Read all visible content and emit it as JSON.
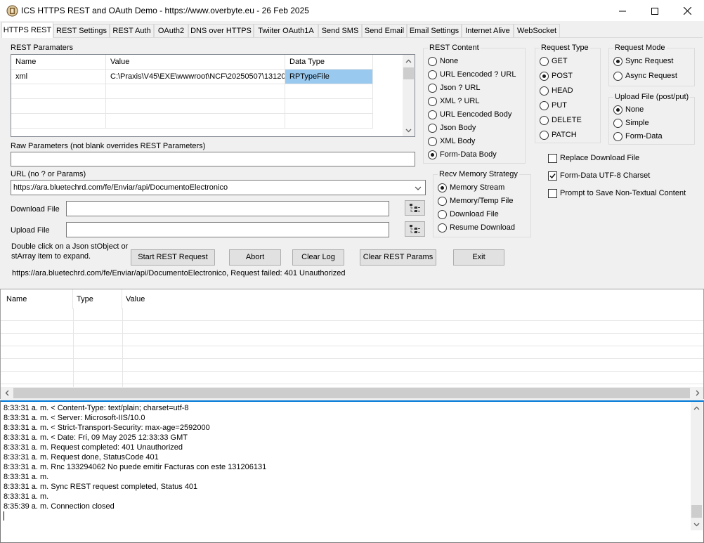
{
  "window": {
    "title": "ICS HTTPS REST and OAuth Demo - https://www.overbyte.eu  - 26 Feb 2025",
    "icons": [
      "app-icon",
      "minimize-icon",
      "maximize-icon",
      "close-icon"
    ]
  },
  "tabs": [
    "HTTPS REST",
    "REST Settings",
    "REST Auth",
    "OAuth2",
    "DNS over HTTPS",
    "Twiiter OAuth1A",
    "Send SMS",
    "Send Email",
    "Email Settings",
    "Internet Alive",
    "WebSocket"
  ],
  "rest_params": {
    "label": "REST Paramaters",
    "columns": [
      "Name",
      "Value",
      "Data Type"
    ],
    "rows": [
      {
        "name": "xml",
        "value": "C:\\Praxis\\V45\\EXE\\wwwroot\\NCF\\20250507\\13120",
        "type": "RPTypeFile"
      }
    ]
  },
  "raw_params": {
    "label": "Raw Parameters (not blank overrides REST Parameters)",
    "value": ""
  },
  "url": {
    "label": "URL (no ? or Params)",
    "value": "https://ara.bluetechrd.com/fe/Enviar/api/DocumentoElectronico"
  },
  "download_file": {
    "label": "Download File",
    "value": ""
  },
  "upload_file": {
    "label": "Upload File",
    "value": ""
  },
  "hint": {
    "line1": "Double click on a Json stObject or",
    "line2": "stArray item to expand."
  },
  "buttons": {
    "start": "Start REST Request",
    "abort": "Abort",
    "clear_log": "Clear Log",
    "clear_params": "Clear REST Params",
    "exit": "Exit"
  },
  "status_text": "https://ara.bluetechrd.com/fe/Enviar/api/DocumentoElectronico, Request failed: 401 Unauthorized",
  "rest_content": {
    "label": "REST Content",
    "options": [
      "None",
      "URL Eencoded ? URL",
      "Json ? URL",
      "XML ? URL",
      "URL Eencoded Body",
      "Json Body",
      "XML Body",
      "Form-Data Body"
    ],
    "selected": "Form-Data Body"
  },
  "request_type": {
    "label": "Request Type",
    "options": [
      "GET",
      "POST",
      "HEAD",
      "PUT",
      "DELETE",
      "PATCH"
    ],
    "selected": "POST"
  },
  "request_mode": {
    "label": "Request Mode",
    "options": [
      "Sync Request",
      "Async Request"
    ],
    "selected": "Sync Request"
  },
  "upload_mode": {
    "label": "Upload File (post/put)",
    "options": [
      "None",
      "Simple",
      "Form-Data"
    ],
    "selected": "None"
  },
  "checkboxes": {
    "replace_download": {
      "label": "Replace Download File",
      "checked": false
    },
    "utf8_charset": {
      "label": "Form-Data UTF-8 Charset",
      "checked": true
    },
    "prompt_save": {
      "label": "Prompt to Save Non-Textual Content",
      "checked": false
    }
  },
  "recv_memory": {
    "label": "Recv Memory Strategy",
    "options": [
      "Memory Stream",
      "Memory/Temp File",
      "Download File",
      "Resume Download"
    ],
    "selected": "Memory Stream"
  },
  "json_grid": {
    "columns": [
      "Name",
      "Type",
      "Value"
    ]
  },
  "log_lines": [
    "8:33:31 a. m. < Content-Type: text/plain; charset=utf-8",
    "8:33:31 a. m. < Server: Microsoft-IIS/10.0",
    "8:33:31 a. m. < Strict-Transport-Security: max-age=2592000",
    "8:33:31 a. m. < Date: Fri, 09 May 2025 12:33:33 GMT",
    "8:33:31 a. m. Request completed: 401 Unauthorized",
    "8:33:31 a. m. Request done, StatusCode 401",
    "8:33:31 a. m. Rnc 133294062 No puede emitir Facturas con este 131206131",
    "8:33:31 a. m.",
    "8:33:31 a. m. Sync REST request completed, Status 401",
    "8:33:31 a. m.",
    "8:35:39 a. m. Connection closed"
  ]
}
